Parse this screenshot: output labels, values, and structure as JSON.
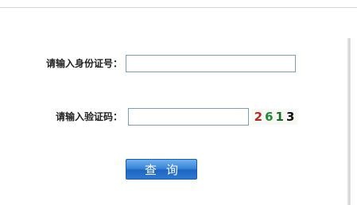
{
  "form": {
    "id_label": "请输入身份证号：",
    "id_value": "",
    "captcha_label": "请输入验证码：",
    "captcha_value": "",
    "captcha_image": {
      "characters": [
        {
          "char": "2",
          "color": "#b22b2b"
        },
        {
          "char": "6",
          "color": "#1e8a3a"
        },
        {
          "char": "1",
          "color": "#1e6a2a"
        },
        {
          "char": "3",
          "color": "#111111"
        }
      ]
    },
    "submit_label": "查询"
  }
}
